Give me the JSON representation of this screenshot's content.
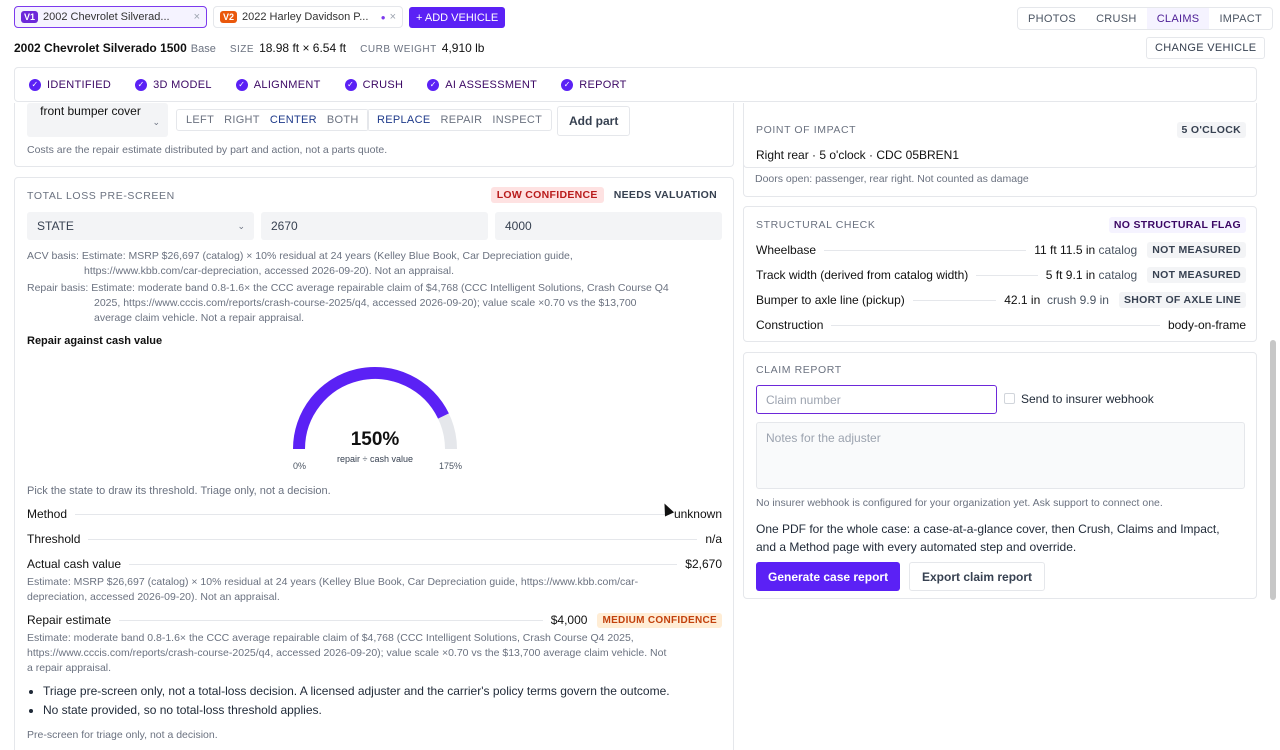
{
  "vehicle_tabs": [
    {
      "badge": "V1",
      "name": "2002 Chevrolet Silverad...",
      "close": "×"
    },
    {
      "badge": "V2",
      "name": "2022 Harley Davidson P...",
      "dot": "●",
      "close": "×"
    }
  ],
  "add_vehicle": "+ ADD VEHICLE",
  "view_tabs": [
    "PHOTOS",
    "CRUSH",
    "CLAIMS",
    "IMPACT"
  ],
  "vehicle": {
    "title": "2002 Chevrolet Silverado 1500",
    "trim": "Base",
    "size_label": "SIZE",
    "size_value": "18.98 ft × 6.54 ft",
    "weight_label": "CURB WEIGHT",
    "weight_value": "4,910 lb"
  },
  "change_vehicle": "CHANGE VEHICLE",
  "steps": [
    "IDENTIFIED",
    "3D MODEL",
    "ALIGNMENT",
    "CRUSH",
    "AI ASSESSMENT",
    "REPORT"
  ],
  "parts": {
    "part_select": "front bumper cover",
    "sides": [
      "LEFT",
      "RIGHT",
      "CENTER",
      "BOTH"
    ],
    "actions": [
      "REPLACE",
      "REPAIR",
      "INSPECT"
    ],
    "add_part": "Add part",
    "note": "Costs are the repair estimate distributed by part and action, not a parts quote."
  },
  "total_loss": {
    "title": "TOTAL LOSS PRE-SCREEN",
    "confidence": "LOW CONFIDENCE",
    "valuation": "NEEDS VALUATION",
    "state": "STATE",
    "acv_input": "2670",
    "repair_input": "4000",
    "acv_basis_label": "ACV basis:",
    "acv_basis_l1": "Estimate: MSRP $26,697 (catalog) × 10% residual at 24 years (Kelley Blue Book, Car Depreciation guide,",
    "acv_basis_l2": "https://www.kbb.com/car-depreciation, accessed 2026-09-20). Not an appraisal.",
    "repair_basis_label": "Repair basis:",
    "repair_basis_l1": "Estimate: moderate band 0.8-1.6× the CCC average repairable claim of $4,768 (CCC Intelligent Solutions, Crash Course Q4",
    "repair_basis_l2": "2025, https://www.cccis.com/reports/crash-course-2025/q4, accessed 2026-09-20); value scale ×0.70 vs the $13,700",
    "repair_basis_l3": "average claim vehicle. Not a repair appraisal.",
    "gauge_heading": "Repair against cash value",
    "gauge_value": "150%",
    "gauge_sub": "repair ÷ cash value",
    "gauge_min": "0%",
    "gauge_max": "175%",
    "gauge_fraction": 0.857,
    "pick_note": "Pick the state to draw its threshold. Triage only, not a decision.",
    "method_label": "Method",
    "method_value": "unknown",
    "threshold_label": "Threshold",
    "threshold_value": "n/a",
    "acv_label": "Actual cash value",
    "acv_value": "$2,670",
    "acv_est_l1": "Estimate: MSRP $26,697 (catalog) × 10% residual at 24 years (Kelley Blue Book, Car Depreciation guide, https://www.kbb.com/car-",
    "acv_est_l2": "depreciation, accessed 2026-09-20). Not an appraisal.",
    "repair_label": "Repair estimate",
    "repair_value": "$4,000",
    "repair_conf": "MEDIUM CONFIDENCE",
    "repair_est_l1": "Estimate: moderate band 0.8-1.6× the CCC average repairable claim of $4,768 (CCC Intelligent Solutions, Crash Course Q4 2025,",
    "repair_est_l2": "https://www.cccis.com/reports/crash-course-2025/q4, accessed 2026-09-20); value scale ×0.70 vs the $13,700 average claim vehicle. Not",
    "repair_est_l3": "a repair appraisal.",
    "bullets": [
      "Triage pre-screen only, not a total-loss decision. A licensed adjuster and the carrier's policy terms govern the outcome.",
      "No state provided, so no total-loss threshold applies."
    ],
    "footer": "Pre-screen for triage only, not a decision."
  },
  "impact": {
    "title": "POINT OF IMPACT",
    "clock": "5 O'CLOCK",
    "summary": "Right rear · 5 o'clock · CDC 05BREN1",
    "doors": "Doors open: passenger, rear right. Not counted as damage"
  },
  "structural": {
    "title": "STRUCTURAL CHECK",
    "flag": "NO STRUCTURAL FLAG",
    "rows": [
      {
        "label": "Wheelbase",
        "value": "11 ft 11.5 in",
        "extra": "catalog",
        "tag": "NOT MEASURED"
      },
      {
        "label": "Track width (derived from catalog width)",
        "value": "5 ft 9.1 in",
        "extra": "catalog",
        "tag": "NOT MEASURED"
      },
      {
        "label": "Bumper to axle line (pickup)",
        "value": "42.1 in",
        "extra": "crush 9.9 in",
        "tag": "SHORT OF AXLE LINE"
      },
      {
        "label": "Construction",
        "value": "body-on-frame",
        "extra": "",
        "tag": ""
      }
    ]
  },
  "claim": {
    "title": "CLAIM REPORT",
    "claim_placeholder": "Claim number",
    "webhook_label": "Send to insurer webhook",
    "notes_placeholder": "Notes for the adjuster",
    "webhook_note": "No insurer webhook is configured for your organization yet. Ask support to connect one.",
    "pdf_l1": "One PDF for the whole case: a case-at-a-glance cover, then Crush, Claims and Impact,",
    "pdf_l2": "and a Method page with every automated step and override.",
    "generate": "Generate case report",
    "export": "Export claim report"
  },
  "colors": {
    "accent": "#5b21f5",
    "danger": "#b91c1c",
    "warning": "#c2410c"
  }
}
